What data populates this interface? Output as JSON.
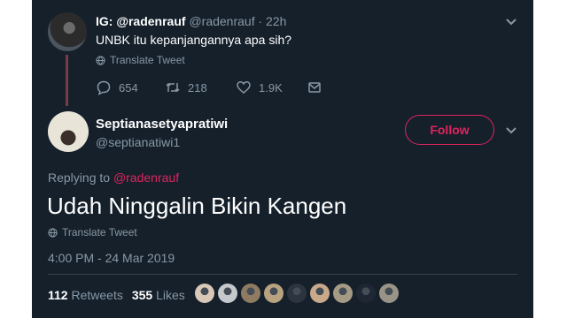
{
  "parent": {
    "name": "IG: @radenrauf",
    "handle": "@radenrauf",
    "time": "· 22h",
    "text": "UNBK itu kepanjangannya apa sih?",
    "translate": "Translate Tweet",
    "replies": "654",
    "retweets": "218",
    "likes": "1.9K"
  },
  "tweet": {
    "name": "Septianasetyapratiwi",
    "handle": "@septianatiwi1",
    "follow_label": "Follow",
    "replying_prefix": "Replying to",
    "replying_to": "@radenrauf",
    "text": "Udah Ninggalin Bikin Kangen",
    "translate": "Translate Tweet",
    "timestamp": "4:00 PM - 24 Mar 2019",
    "retweets_count": "112",
    "retweets_label": "Retweets",
    "likes_count": "355",
    "likes_label": "Likes"
  },
  "colors": {
    "background": "#15202b",
    "accent": "#e0245e",
    "muted": "#8899a6"
  },
  "likers": [
    {
      "color": "#d9c7b8"
    },
    {
      "color": "#c5c9cc"
    },
    {
      "color": "#8f7a62"
    },
    {
      "color": "#b9a27f"
    },
    {
      "color": "#2c3440"
    },
    {
      "color": "#c9a98a"
    },
    {
      "color": "#a59b85"
    },
    {
      "color": "#1e2733"
    },
    {
      "color": "#9a9488"
    }
  ]
}
